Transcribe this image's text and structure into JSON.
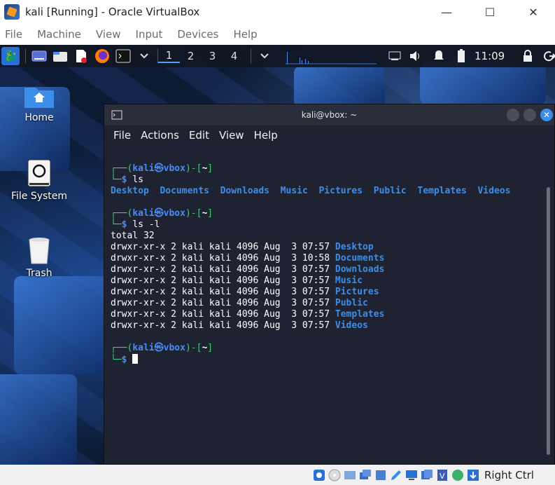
{
  "window": {
    "title": "kali [Running] - Oracle VirtualBox",
    "controls": {
      "minimize": "—",
      "maximize": "☐",
      "close": "✕"
    }
  },
  "vbox_menu": [
    "File",
    "Machine",
    "View",
    "Input",
    "Devices",
    "Help"
  ],
  "panel": {
    "workspaces": [
      "1",
      "2",
      "3",
      "4"
    ],
    "active_workspace": 0,
    "clock": "11:09",
    "icons": [
      "kali-menu-icon",
      "show-desktop-icon",
      "file-manager-icon",
      "text-editor-icon",
      "firefox-icon",
      "terminal-icon",
      "chevron-down-icon",
      "cpu-graph",
      "network-icon",
      "volume-icon",
      "notification-icon",
      "battery-icon",
      "lock-icon",
      "logout-icon"
    ]
  },
  "desktop": {
    "icons": [
      {
        "label": "Home"
      },
      {
        "label": "File System"
      },
      {
        "label": "Trash"
      }
    ]
  },
  "terminal": {
    "title": "kali@vbox: ~",
    "menu": [
      "File",
      "Actions",
      "Edit",
      "View",
      "Help"
    ],
    "prompt": {
      "open": "┌──(",
      "user": "kali",
      "at": "㉿",
      "host": "vbox",
      "mid": ")-[",
      "path": "~",
      "close": "]",
      "second": "└─",
      "dollar": "$"
    },
    "commands": [
      "ls",
      "ls -l"
    ],
    "ls_output": [
      "Desktop",
      "Documents",
      "Downloads",
      "Music",
      "Pictures",
      "Public",
      "Templates",
      "Videos"
    ],
    "total_line": "total 32",
    "ls_long": [
      {
        "perm": "drwxr-xr-x 2 kali kali 4096 Aug  3 07:57 ",
        "name": "Desktop"
      },
      {
        "perm": "drwxr-xr-x 2 kali kali 4096 Aug  3 10:58 ",
        "name": "Documents"
      },
      {
        "perm": "drwxr-xr-x 2 kali kali 4096 Aug  3 07:57 ",
        "name": "Downloads"
      },
      {
        "perm": "drwxr-xr-x 2 kali kali 4096 Aug  3 07:57 ",
        "name": "Music"
      },
      {
        "perm": "drwxr-xr-x 2 kali kali 4096 Aug  3 07:57 ",
        "name": "Pictures"
      },
      {
        "perm": "drwxr-xr-x 2 kali kali 4096 Aug  3 07:57 ",
        "name": "Public"
      },
      {
        "perm": "drwxr-xr-x 2 kali kali 4096 Aug  3 07:57 ",
        "name": "Templates"
      },
      {
        "perm": "drwxr-xr-x 2 kali kali 4096 Aug  3 07:57 ",
        "name": "Videos"
      }
    ]
  },
  "status_bar": {
    "host_key": "Right Ctrl"
  },
  "colors": {
    "prompt_green": "#3ad07a",
    "prompt_blue": "#4a8cf7",
    "dir_blue": "#3b8eea",
    "terminal_bg": "#1e2231"
  }
}
